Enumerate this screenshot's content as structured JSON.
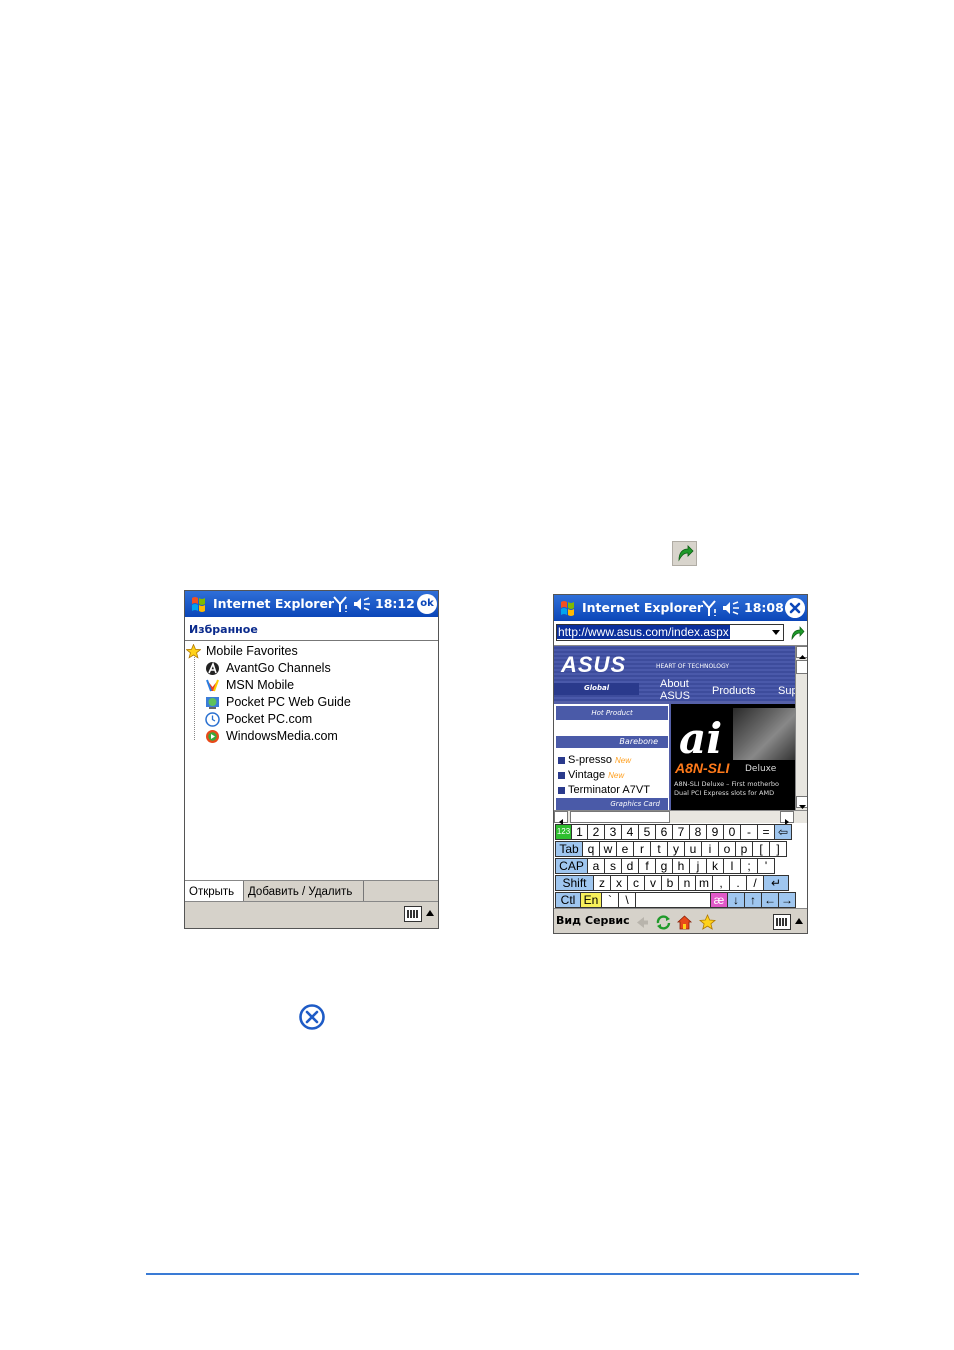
{
  "left_screen": {
    "title": "Internet Explorer",
    "time": "18:12",
    "ok_label": "ok",
    "header": "Избранное",
    "tree": [
      {
        "label": "Mobile Favorites",
        "icon": "star-icon"
      },
      {
        "label": "AvantGo Channels",
        "icon": "avantgo-icon"
      },
      {
        "label": "MSN Mobile",
        "icon": "msn-icon"
      },
      {
        "label": "Pocket PC Web Guide",
        "icon": "globe-icon"
      },
      {
        "label": "Pocket PC.com",
        "icon": "clock-icon"
      },
      {
        "label": "WindowsMedia.com",
        "icon": "windowsmedia-icon"
      }
    ],
    "tabs": [
      "Открыть",
      "Добавить / Удалить"
    ]
  },
  "right_screen": {
    "title": "Internet Explorer",
    "time": "18:08",
    "address": "http://www.asus.com/index.aspx",
    "web": {
      "logo": "ASUS",
      "tagline": "HEART OF TECHNOLOGY",
      "global": "Global",
      "nav": [
        "About ASUS",
        "Products",
        "Sup"
      ],
      "hot_product": "Hot Product",
      "barebone": "Barebone",
      "products": [
        {
          "name": "S-presso",
          "new": "New"
        },
        {
          "name": "Vintage",
          "new": "New"
        },
        {
          "name": "Terminator A7VT",
          "new": ""
        }
      ],
      "graphics": "Graphics Card",
      "ad_title": "A8N-SLI",
      "ad_deluxe": "Deluxe",
      "ad_line1": "A8N-SLI Deluxe – First motherbo",
      "ad_line2": "Dual PCI Express slots for AMD"
    },
    "keyboard": {
      "row1": [
        "123",
        "1",
        "2",
        "3",
        "4",
        "5",
        "6",
        "7",
        "8",
        "9",
        "0",
        "-",
        "=",
        "⇦"
      ],
      "row2": [
        "Tab",
        "q",
        "w",
        "e",
        "r",
        "t",
        "y",
        "u",
        "i",
        "o",
        "p",
        "[",
        "]"
      ],
      "row3": [
        "CAP",
        "a",
        "s",
        "d",
        "f",
        "g",
        "h",
        "j",
        "k",
        "l",
        ";",
        "'"
      ],
      "row4": [
        "Shift",
        "z",
        "x",
        "c",
        "v",
        "b",
        "n",
        "m",
        ",",
        ".",
        "/",
        "↵"
      ],
      "row5": [
        "Ctl",
        "En",
        "`",
        "\\",
        "",
        "æ",
        "↓",
        "↑",
        "←",
        "→"
      ]
    },
    "menu": [
      "Вид",
      "Сервис"
    ]
  }
}
